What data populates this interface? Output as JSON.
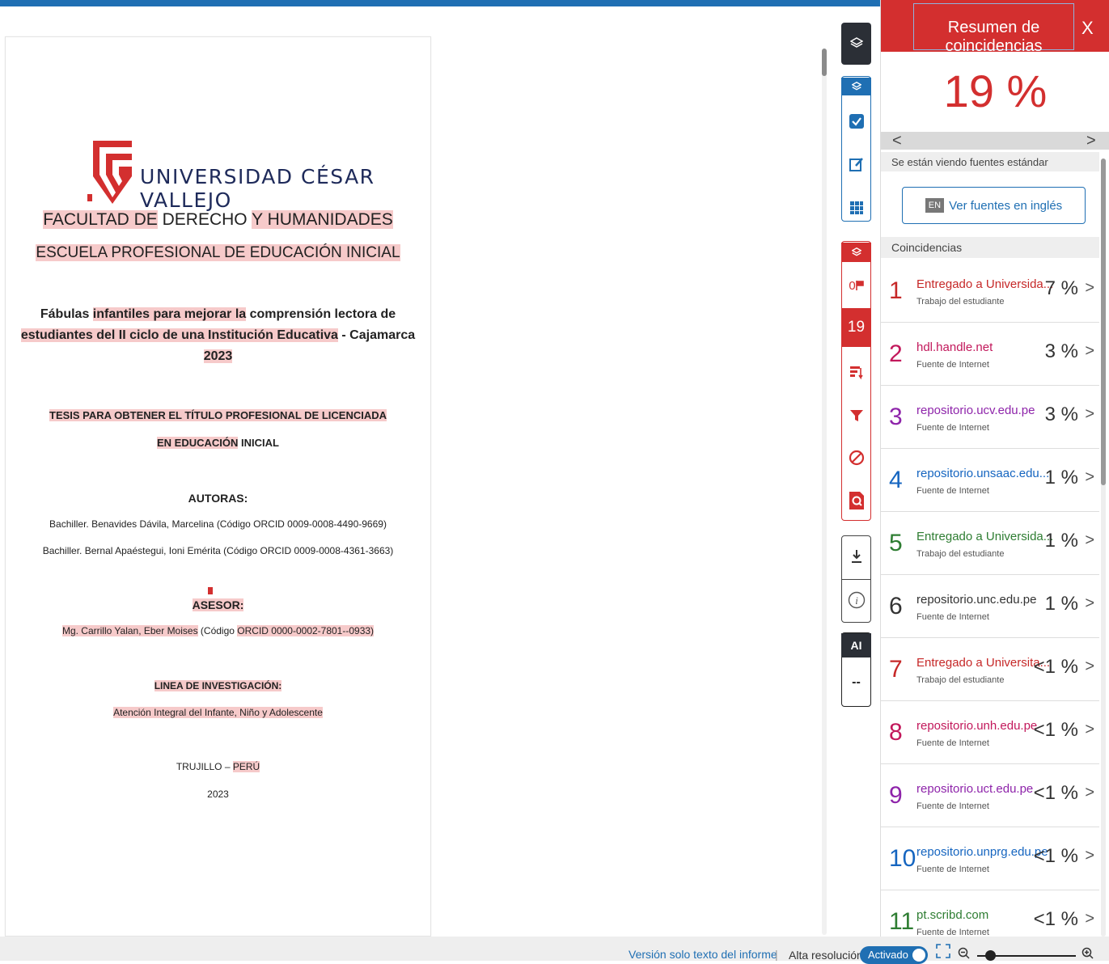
{
  "document": {
    "logo_text_main": "UNIVERSIDAD CÉSAR VALLEJO",
    "faculty_a": "FACULTAD DE",
    "faculty_b": " DERECHO ",
    "faculty_c": "Y HUMANIDADES",
    "school": "ESCUELA PROFESIONAL DE EDUCACIÓN INICIAL",
    "title_1a": "Fábulas ",
    "title_1b": "infantiles para mejorar la",
    "title_1c": " comprensión lectora de",
    "title_2a": "estudiantes del II ciclo de una Institución Educativa",
    "title_2b": " - Cajamarca",
    "title_3": "2023",
    "thesis_1": "TESIS PARA OBTENER EL TÍTULO PROFESIONAL DE LICENCIADA",
    "thesis_2a": "EN EDUCACIÓN",
    "thesis_2b": " INICIAL",
    "authors_label": "AUTORAS:",
    "author_1": "Bachiller. Benavides Dávila, Marcelina (Código ORCID 0009-0008-4490-9669)",
    "author_2": "Bachiller. Bernal Apaéstegui, Ioni Emérita (Código ORCID 0009-0008-4361-3663)",
    "advisor_label": "ASESOR:",
    "advisor_a": "Mg. Carrillo Yalan, Eber Moises",
    "advisor_b": " (Código ",
    "advisor_c": "ORCID 0000-0002-7801--0933)",
    "line_label": "LINEA DE INVESTIGACIÓN:",
    "line_value": "Atención Integral del Infante, Niño y Adolescente",
    "city_a": "TRUJILLO – ",
    "city_b": "PERÚ",
    "year": "2023"
  },
  "toolbar": {
    "flag_count": "0",
    "match_count": "19",
    "ai_label": "AI",
    "ai_value": "--"
  },
  "panel": {
    "title": "Resumen de coincidencias",
    "close": "X",
    "percent": "19 %",
    "prev": "<",
    "next": ">",
    "viewing": "Se están viendo fuentes estándar",
    "en_tag": "EN",
    "en_button": "Ver fuentes en inglés",
    "matches_header": "Coincidencias",
    "matches": [
      {
        "num": "1",
        "source": "Entregado a Universida...",
        "type": "Trabajo del estudiante",
        "pct": "7 %",
        "color": "#c62828"
      },
      {
        "num": "2",
        "source": "hdl.handle.net",
        "type": "Fuente de Internet",
        "pct": "3 %",
        "color": "#c2185b"
      },
      {
        "num": "3",
        "source": "repositorio.ucv.edu.pe",
        "type": "Fuente de Internet",
        "pct": "3 %",
        "color": "#8e24aa"
      },
      {
        "num": "4",
        "source": "repositorio.unsaac.edu...",
        "type": "Fuente de Internet",
        "pct": "1 %",
        "color": "#1565c0"
      },
      {
        "num": "5",
        "source": "Entregado a Universida...",
        "type": "Trabajo del estudiante",
        "pct": "1 %",
        "color": "#2e7d32"
      },
      {
        "num": "6",
        "source": "repositorio.unc.edu.pe",
        "type": "Fuente de Internet",
        "pct": "1 %",
        "color": "#333333"
      },
      {
        "num": "7",
        "source": "Entregado a Universita...",
        "type": "Trabajo del estudiante",
        "pct": "<1 %",
        "color": "#c62828"
      },
      {
        "num": "8",
        "source": "repositorio.unh.edu.pe",
        "type": "Fuente de Internet",
        "pct": "<1 %",
        "color": "#c2185b"
      },
      {
        "num": "9",
        "source": "repositorio.uct.edu.pe",
        "type": "Fuente de Internet",
        "pct": "<1 %",
        "color": "#8e24aa"
      },
      {
        "num": "10",
        "source": "repositorio.unprg.edu.pe",
        "type": "Fuente de Internet",
        "pct": "<1 %",
        "color": "#1565c0"
      },
      {
        "num": "11",
        "source": "pt.scribd.com",
        "type": "Fuente de Internet",
        "pct": "<1 %",
        "color": "#2e7d32"
      }
    ]
  },
  "statusbar": {
    "text_only": "Versión solo texto del informe",
    "separator": "|",
    "high_res": "Alta resolución",
    "toggle": "Activado"
  },
  "colors": {
    "accent_red": "#d32f2f",
    "accent_blue": "#1f6fb3",
    "highlight": "#f6caca"
  }
}
